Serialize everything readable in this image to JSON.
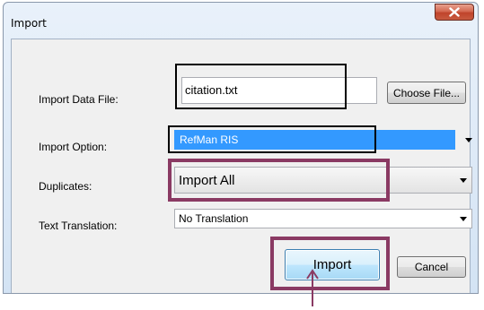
{
  "window": {
    "title": "Import"
  },
  "form": {
    "import_data_file_label": "Import Data File:",
    "import_data_file_value": "citation.txt",
    "choose_file_label": "Choose File...",
    "import_option_label": "Import Option:",
    "import_option_value": "RefMan RIS",
    "duplicates_label": "Duplicates:",
    "duplicates_value": "Import All",
    "text_translation_label": "Text Translation:",
    "text_translation_value": "No Translation"
  },
  "buttons": {
    "import_label": "Import",
    "cancel_label": "Cancel"
  },
  "colors": {
    "selection": "#3399ff",
    "highlight_frame": "#8a3a63",
    "close_button": "#c75a40"
  },
  "icons": {
    "close": "close-icon",
    "dropdown": "chevron-down-icon",
    "pointer": "arrow-up-icon"
  }
}
